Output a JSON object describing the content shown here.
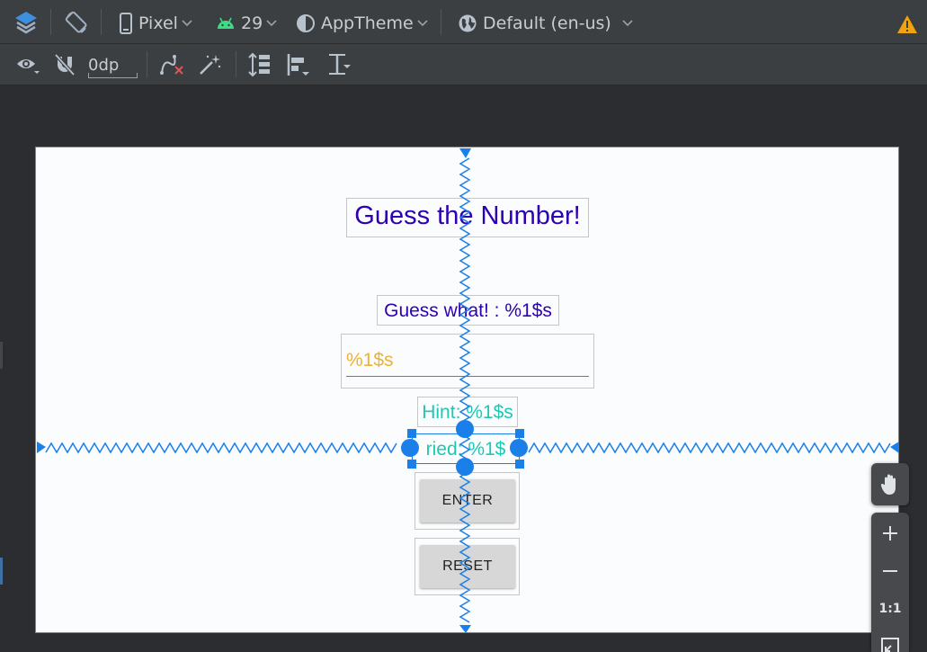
{
  "toolbar": {
    "device": "Pixel",
    "api_level": "29",
    "theme": "AppTheme",
    "locale": "Default (en-us)"
  },
  "toolbar2": {
    "margin_value": "0dp"
  },
  "design": {
    "title": "Guess the Number!",
    "guess_label": "Guess what! : %1$s",
    "input_hint": "%1$s",
    "hint_text": "Hint: %1$s",
    "tried_text": "ried: %1$",
    "enter_button": "ENTER",
    "reset_button": "RESET"
  },
  "zoom": {
    "reset_label": "1:1"
  },
  "colors": {
    "title": "#2d00b3",
    "hint": "#1fc8b4",
    "placeholder": "#f0b22e",
    "selection": "#1a7fe8",
    "warning": "#f0a30a"
  }
}
